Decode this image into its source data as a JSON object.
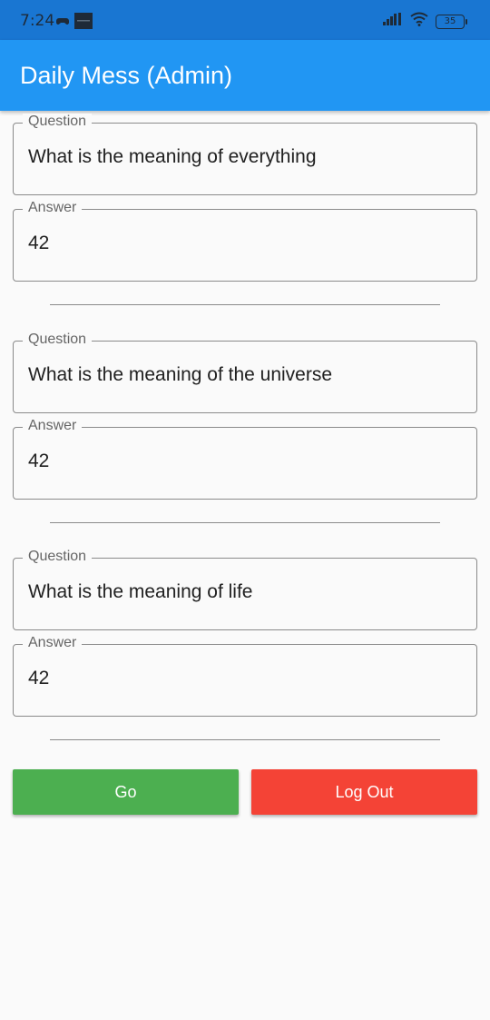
{
  "status_bar": {
    "time": "7:24",
    "battery": "35",
    "icons": [
      "game-controller-icon",
      "notification-image-icon",
      "signal-icon",
      "wifi-icon",
      "battery-icon"
    ]
  },
  "app_bar": {
    "title": "Daily Mess (Admin)",
    "color": "#2196f3"
  },
  "entries": [
    {
      "question_label": "Question",
      "question_value": "What is the meaning of everything",
      "answer_label": "Answer",
      "answer_value": "42"
    },
    {
      "question_label": "Question",
      "question_value": "What is the meaning of the universe",
      "answer_label": "Answer",
      "answer_value": "42"
    },
    {
      "question_label": "Question",
      "question_value": "What is the meaning of life",
      "answer_label": "Answer",
      "answer_value": "42"
    }
  ],
  "actions": {
    "go_label": "Go",
    "go_color": "#4caf50",
    "logout_label": "Log Out",
    "logout_color": "#f44336"
  }
}
